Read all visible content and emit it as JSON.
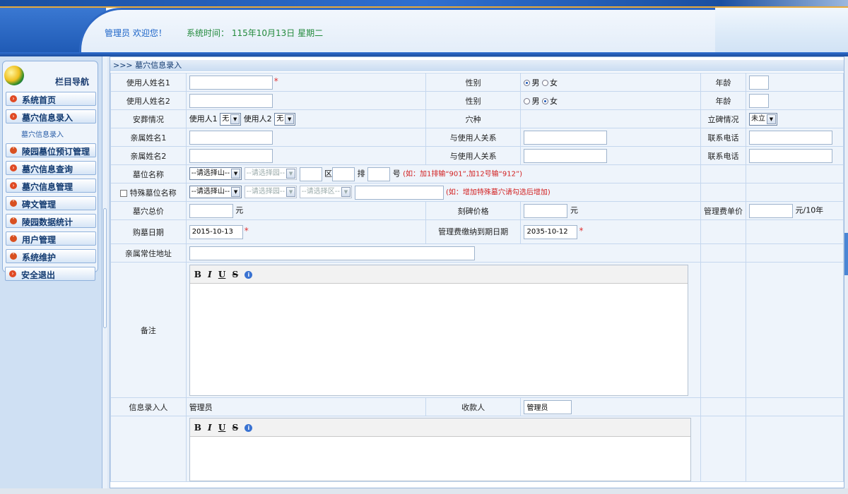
{
  "header": {
    "welcome": "管理员  欢迎您！",
    "systime": "系统时间： 115年10月13日 星期二"
  },
  "sidebar": {
    "title": "栏目导航",
    "items": [
      {
        "label": "系统首页"
      },
      {
        "label": "墓穴信息录入"
      },
      {
        "label": "陵园墓位预订管理"
      },
      {
        "label": "墓穴信息查询"
      },
      {
        "label": "墓穴信息管理"
      },
      {
        "label": "碑文管理"
      },
      {
        "label": "陵园数据统计"
      },
      {
        "label": "用户管理"
      },
      {
        "label": "系统维护"
      },
      {
        "label": "安全退出"
      }
    ],
    "submenu": "墓穴信息录入"
  },
  "main": {
    "breadcrumb": ">>> 墓穴信息录入",
    "labels": {
      "user1": "使用人姓名1",
      "user2": "使用人姓名2",
      "gender": "性别",
      "age": "年龄",
      "burial": "安葬情况",
      "tomb_type": "穴种",
      "stele": "立碑情况",
      "relative1": "亲属姓名1",
      "relative2": "亲属姓名2",
      "relation": "与使用人关系",
      "phone": "联系电话",
      "plot": "墓位名称",
      "special_plot": "特殊墓位名称",
      "total_price": "墓穴总价",
      "engrave_price": "刻碑价格",
      "fee_unit": "管理费单价",
      "purchase_date": "购墓日期",
      "fee_due": "管理费缴纳到期日期",
      "address": "亲属常住地址",
      "remark": "备注",
      "entered_by": "信息录入人",
      "payee": "收款人"
    },
    "gender_options": {
      "male": "男",
      "female": "女"
    },
    "burial": {
      "user1_label": "使用人1",
      "user1_value": "无",
      "user2_label": "使用人2",
      "user2_value": "无"
    },
    "stele_value": "未立",
    "plot": {
      "mountain": "--请选择山--",
      "garden": "--请选择园--",
      "zone_unit": "区",
      "row_unit": "排",
      "num_unit": "号",
      "hint": "(如：加1排输“901”,加12号输“912”)"
    },
    "special_plot": {
      "mountain": "--请选择山--",
      "garden": "--请选择园--",
      "zone": "--请选择区--",
      "hint": "(如：增加特殊墓穴请勾选后增加)"
    },
    "units": {
      "yuan": "元",
      "per_10y": "元/10年"
    },
    "purchase_date": "2015-10-13",
    "fee_due_date": "2035-10-12",
    "entered_by": "管理员",
    "payee": "管理员",
    "editor_toolbar": {
      "bold": "B",
      "italic": "I",
      "underline": "U",
      "strike": "S",
      "info": "i"
    }
  }
}
